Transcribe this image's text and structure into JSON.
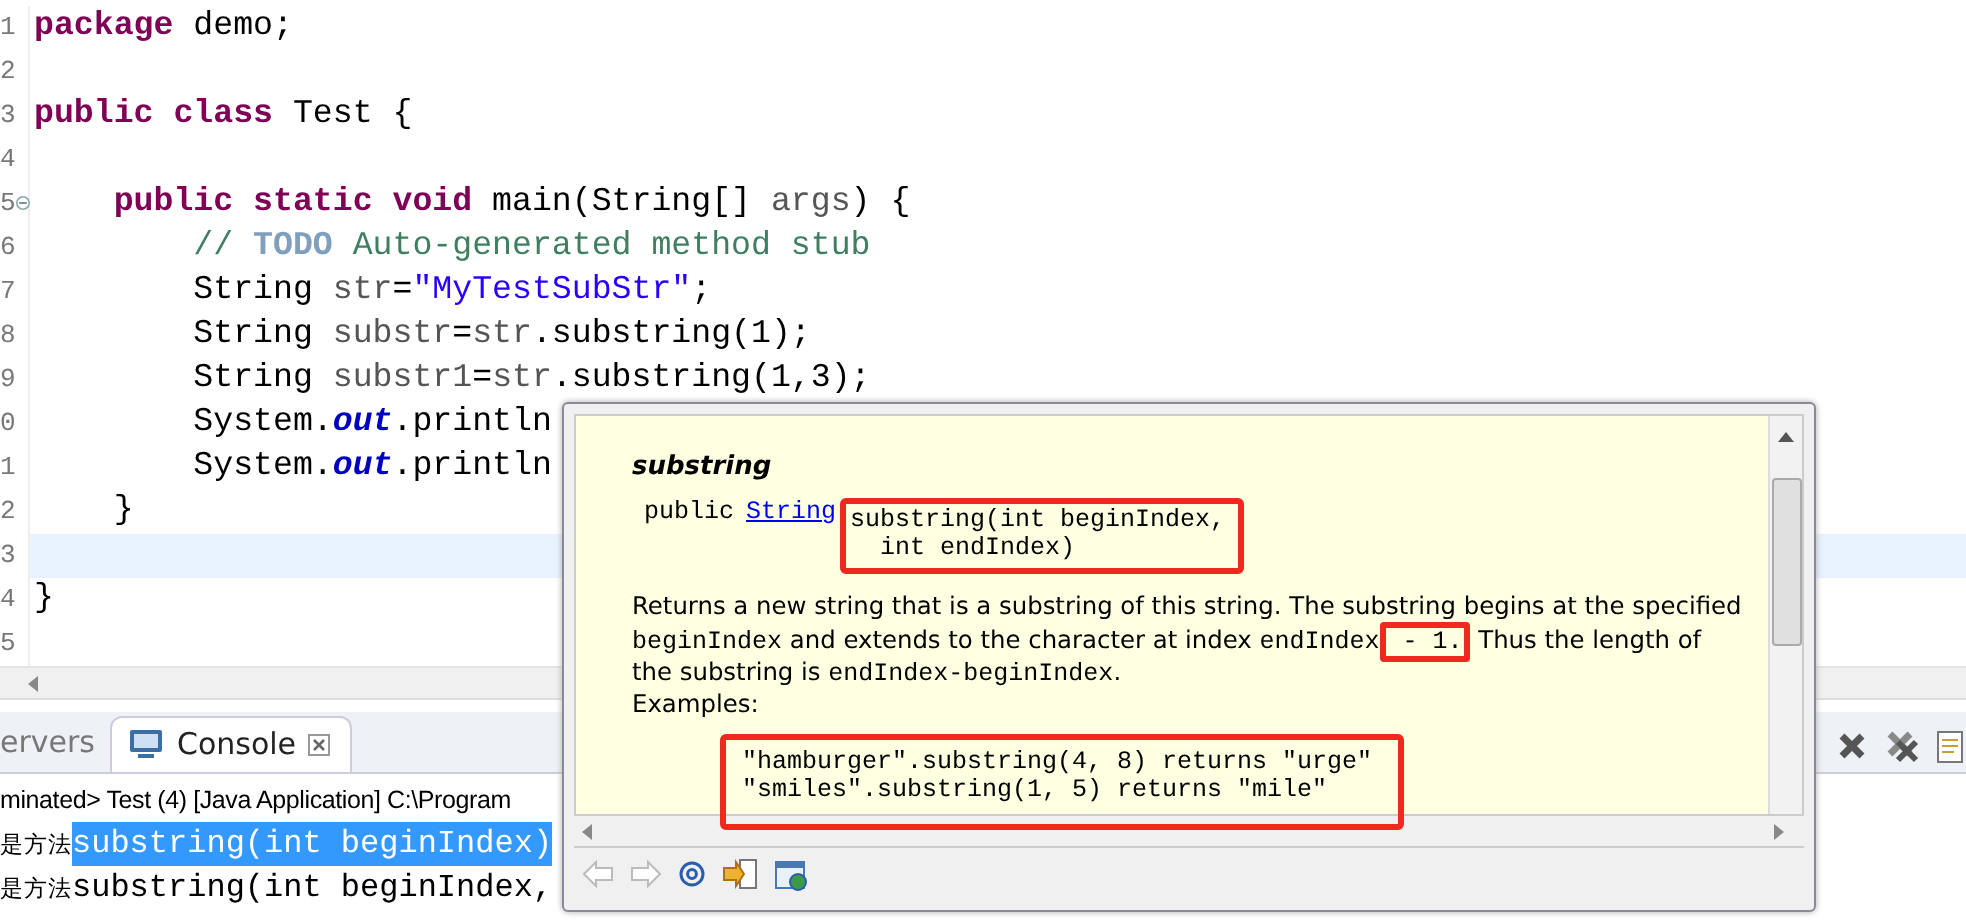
{
  "editor": {
    "lines": [
      {
        "number": "1",
        "fold": false,
        "current": false,
        "tokens": [
          {
            "kind": "kw",
            "text": "package"
          },
          {
            "kind": "plain",
            "text": " demo;"
          }
        ]
      },
      {
        "number": "2",
        "fold": false,
        "current": false
      },
      {
        "number": "3",
        "fold": false,
        "current": false,
        "tokens": [
          {
            "kind": "kw",
            "text": "public class"
          },
          {
            "kind": "plain",
            "text": " Test {"
          }
        ]
      },
      {
        "number": "4",
        "fold": false,
        "current": false
      },
      {
        "number": "5",
        "fold": true,
        "current": false,
        "tokens": [
          {
            "kind": "kw",
            "text": "    public static void"
          },
          {
            "kind": "plain",
            "text": " main(String[] "
          },
          {
            "kind": "var",
            "text": "args"
          },
          {
            "kind": "plain",
            "text": ") {"
          }
        ]
      },
      {
        "number": "6",
        "fold": false,
        "current": false,
        "tokens": [
          {
            "kind": "comment",
            "text": "        // "
          },
          {
            "kind": "todo",
            "text": "TODO"
          },
          {
            "kind": "comment",
            "text": " Auto-generated method stub"
          }
        ]
      },
      {
        "number": "7",
        "fold": false,
        "current": false,
        "tokens": [
          {
            "kind": "plain",
            "text": "        String "
          },
          {
            "kind": "var",
            "text": "str"
          },
          {
            "kind": "plain",
            "text": "="
          },
          {
            "kind": "string",
            "text": "\"MyTestSubStr\""
          },
          {
            "kind": "plain",
            "text": ";"
          }
        ]
      },
      {
        "number": "8",
        "fold": false,
        "current": false,
        "tokens": [
          {
            "kind": "plain",
            "text": "        String "
          },
          {
            "kind": "var",
            "text": "substr"
          },
          {
            "kind": "plain",
            "text": "="
          },
          {
            "kind": "var",
            "text": "str"
          },
          {
            "kind": "plain",
            "text": ".substring(1);"
          }
        ]
      },
      {
        "number": "9",
        "fold": false,
        "current": false,
        "tokens": [
          {
            "kind": "plain",
            "text": "        String "
          },
          {
            "kind": "var",
            "text": "substr1"
          },
          {
            "kind": "plain",
            "text": "="
          },
          {
            "kind": "var",
            "text": "str"
          },
          {
            "kind": "plain",
            "text": ".substring(1,3);"
          }
        ]
      },
      {
        "number": "0",
        "fold": false,
        "current": false,
        "tokens": [
          {
            "kind": "plain",
            "text": "        System."
          },
          {
            "kind": "field",
            "text": "out"
          },
          {
            "kind": "plain",
            "text": ".println"
          }
        ]
      },
      {
        "number": "1",
        "fold": false,
        "current": false,
        "tokens": [
          {
            "kind": "plain",
            "text": "        System."
          },
          {
            "kind": "field",
            "text": "out"
          },
          {
            "kind": "plain",
            "text": ".println"
          }
        ]
      },
      {
        "number": "2",
        "fold": false,
        "current": false,
        "tokens": [
          {
            "kind": "plain",
            "text": "    }"
          }
        ]
      },
      {
        "number": "3",
        "fold": false,
        "current": true
      },
      {
        "number": "4",
        "fold": false,
        "current": false,
        "tokens": [
          {
            "kind": "plain",
            "text": "}"
          }
        ]
      },
      {
        "number": "5",
        "fold": false,
        "current": false
      }
    ]
  },
  "console": {
    "tabs": [
      {
        "label": "ervers",
        "selected": false,
        "icon": false,
        "closable": false
      },
      {
        "label": "Console",
        "selected": true,
        "icon": true,
        "closable": true
      }
    ],
    "status": "minated> Test (4) [Java Application] C:\\Program",
    "output": [
      [
        {
          "text": "是方法",
          "selected": false
        },
        {
          "text": "substring(int beginIndex)",
          "selected": true
        }
      ],
      [
        {
          "text": "是方法",
          "selected": false
        },
        {
          "text": "substring(int beginIndex,",
          "selected": false
        }
      ]
    ]
  },
  "javadoc": {
    "title": "substring",
    "signature": {
      "modifier": "public",
      "return_type": "String",
      "declaration": "substring(int beginIndex,\n  int endIndex)"
    },
    "description": [
      {
        "kind": "text",
        "text": "Returns a new string that is a substring of this string. The substring begins at the specified "
      },
      {
        "kind": "code",
        "text": "beginIndex"
      },
      {
        "kind": "text",
        "text": " and extends to the character at index "
      },
      {
        "kind": "code",
        "text": "endIndex"
      },
      {
        "kind": "mark",
        "text": " - 1."
      },
      {
        "kind": "text",
        "text": " Thus the length of the substring is "
      },
      {
        "kind": "code",
        "text": "endIndex-beginIndex"
      },
      {
        "kind": "text",
        "text": "."
      }
    ],
    "examples_label": "Examples:",
    "examples": [
      "\"hamburger\".substring(4, 8) returns \"urge\"",
      "\"smiles\".substring(1, 5) returns \"mile\""
    ]
  }
}
